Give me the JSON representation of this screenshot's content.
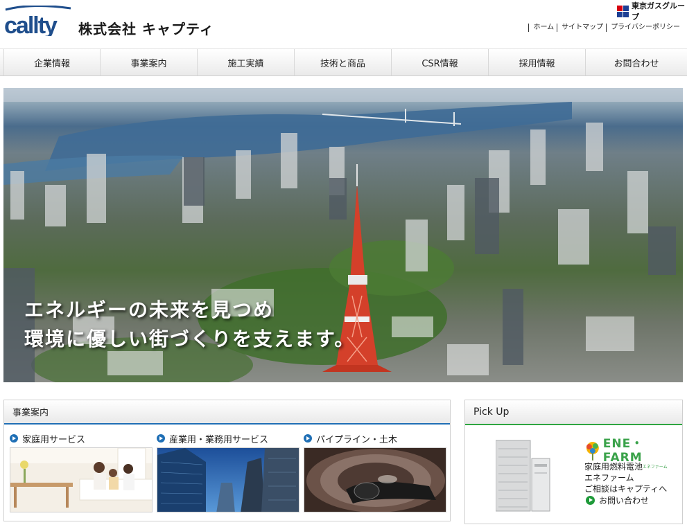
{
  "header": {
    "logo_text": "callty",
    "company_name": "株式会社 キャプティ",
    "group_name": "東京ガスグループ",
    "top_links": [
      "ホーム",
      "サイトマップ",
      "プライバシーポリシー"
    ]
  },
  "nav": {
    "items": [
      "企業情報",
      "事業案内",
      "施工実績",
      "技術と商品",
      "CSR情報",
      "採用情報",
      "お問合わせ"
    ]
  },
  "hero": {
    "line1": "エネルギーの未来を見つめ",
    "line2": "環境に優しい街づくりを支えます。"
  },
  "business": {
    "heading": "事業案内",
    "services": [
      {
        "label": "家庭用サービス"
      },
      {
        "label": "産業用・業務用サービス"
      },
      {
        "label": "パイプライン・土木"
      }
    ]
  },
  "pickup": {
    "heading": "Pick Up",
    "brand": "ENE・FARM",
    "brand_sub": "エネファーム",
    "desc_lines": [
      "家庭用燃料電池",
      "エネファーム",
      "ご相談はキャプティへ"
    ],
    "link_label": "お問い合わせ"
  },
  "colors": {
    "brand_blue": "#1f4e8c",
    "panel_accent_blue": "#1f6fb5",
    "panel_accent_green": "#2fa640",
    "tokyo_gas_red": "#d7000f",
    "tokyo_gas_blue": "#1d3f94"
  }
}
